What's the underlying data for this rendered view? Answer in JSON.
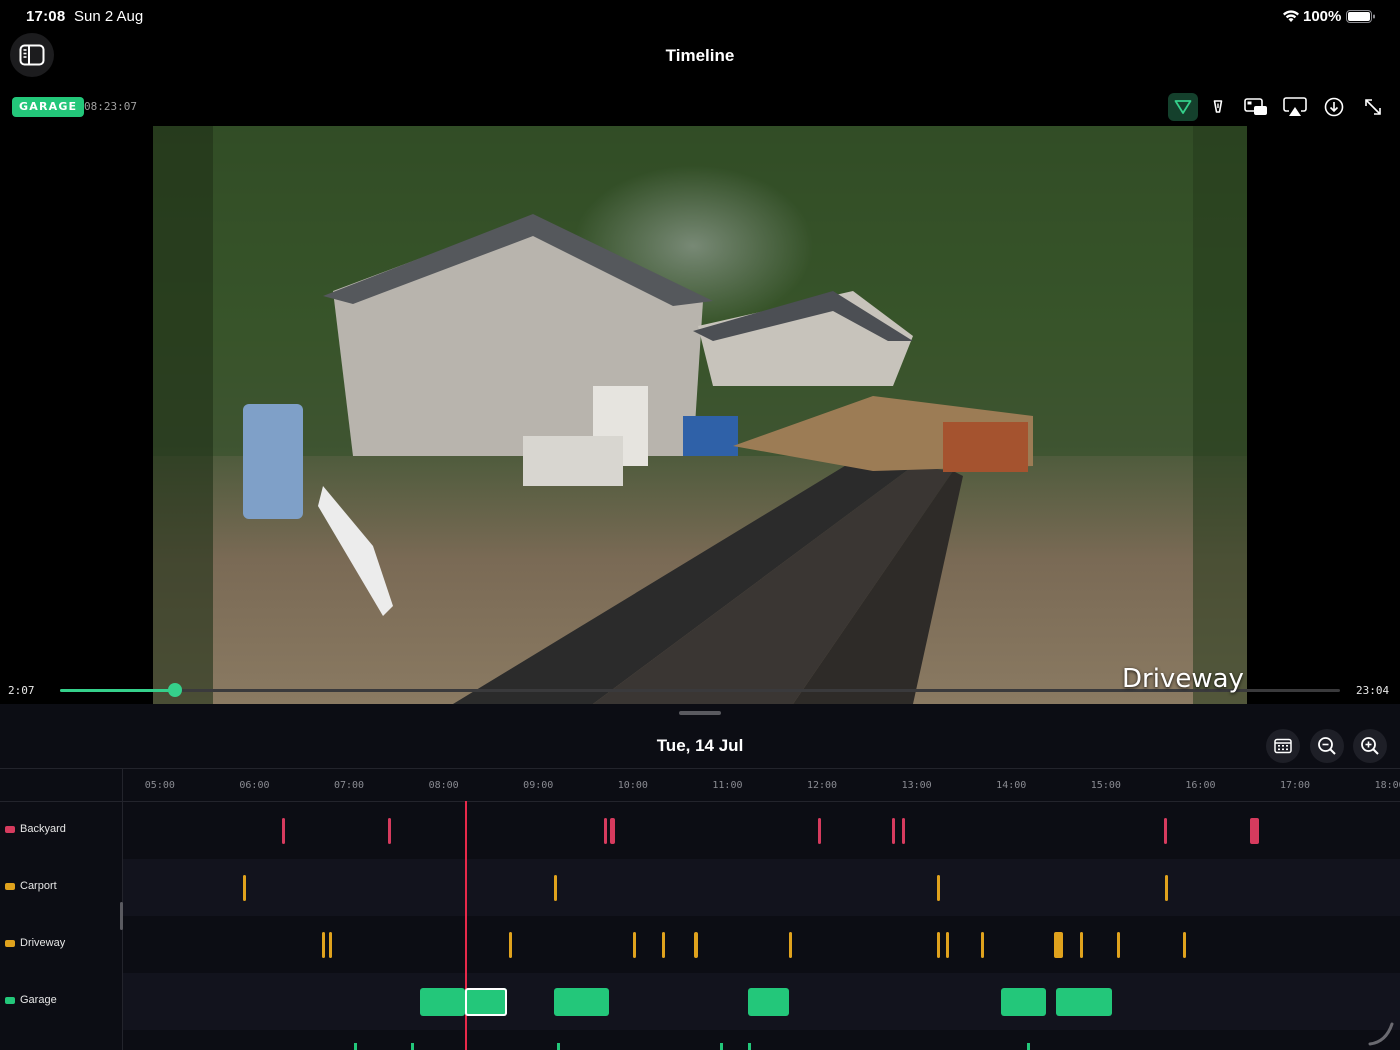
{
  "status": {
    "time": "17:08",
    "date": "Sun 2 Aug",
    "battery": "100%"
  },
  "header": {
    "title": "Timeline"
  },
  "camera": {
    "badge": "GARAGE",
    "timestamp": "08:23:07",
    "overlay_name": "Driveway"
  },
  "toolbar": {
    "icons": [
      "filter-icon",
      "sensor-icon",
      "picture-in-picture-icon",
      "airplay-icon",
      "download-icon",
      "expand-icon"
    ],
    "active_icon": "filter-icon"
  },
  "scrubber": {
    "start": "2:07",
    "end": "23:04",
    "progress": 0.09
  },
  "timeline": {
    "day": "Tue, 14 Jul",
    "ticks": [
      "05:00",
      "06:00",
      "07:00",
      "08:00",
      "09:00",
      "10:00",
      "11:00",
      "12:00",
      "13:00",
      "14:00",
      "15:00",
      "16:00",
      "17:00",
      "18:00"
    ],
    "playhead_hour": 8.24,
    "rows": [
      {
        "name": "Backyard",
        "color": "#d63b5e",
        "events": [
          [
            6.29,
            0.03
          ],
          [
            7.41,
            0.02
          ],
          [
            9.69,
            0.02
          ],
          [
            9.76,
            0.05
          ],
          [
            11.96,
            0.02
          ],
          [
            12.74,
            0.03
          ],
          [
            12.84,
            0.02
          ],
          [
            15.61,
            0.03
          ],
          [
            16.52,
            0.1
          ]
        ]
      },
      {
        "name": "Carport",
        "color": "#e0a21d",
        "events": [
          [
            5.88,
            0.02
          ],
          [
            9.17,
            0.02
          ],
          [
            13.22,
            0.03
          ],
          [
            15.63,
            0.02
          ]
        ]
      },
      {
        "name": "Driveway",
        "color": "#e0a21d",
        "events": [
          [
            6.71,
            0.02
          ],
          [
            6.79,
            0.02
          ],
          [
            8.69,
            0.02
          ],
          [
            10.0,
            0.02
          ],
          [
            10.31,
            0.02
          ],
          [
            10.65,
            0.04
          ],
          [
            11.65,
            0.03
          ],
          [
            13.21,
            0.03
          ],
          [
            13.31,
            0.02
          ],
          [
            13.68,
            0.02
          ],
          [
            14.45,
            0.1
          ],
          [
            14.73,
            0.02
          ],
          [
            15.12,
            0.02
          ],
          [
            15.82,
            0.03
          ]
        ]
      },
      {
        "name": "Garage",
        "color": "#23c77a",
        "events": [
          [
            7.75,
            0.48
          ],
          [
            8.23,
            0.44
          ],
          [
            9.17,
            0.58
          ],
          [
            11.22,
            0.43
          ],
          [
            13.89,
            0.48
          ],
          [
            14.47,
            0.59
          ]
        ],
        "selected_index": 1
      }
    ]
  }
}
